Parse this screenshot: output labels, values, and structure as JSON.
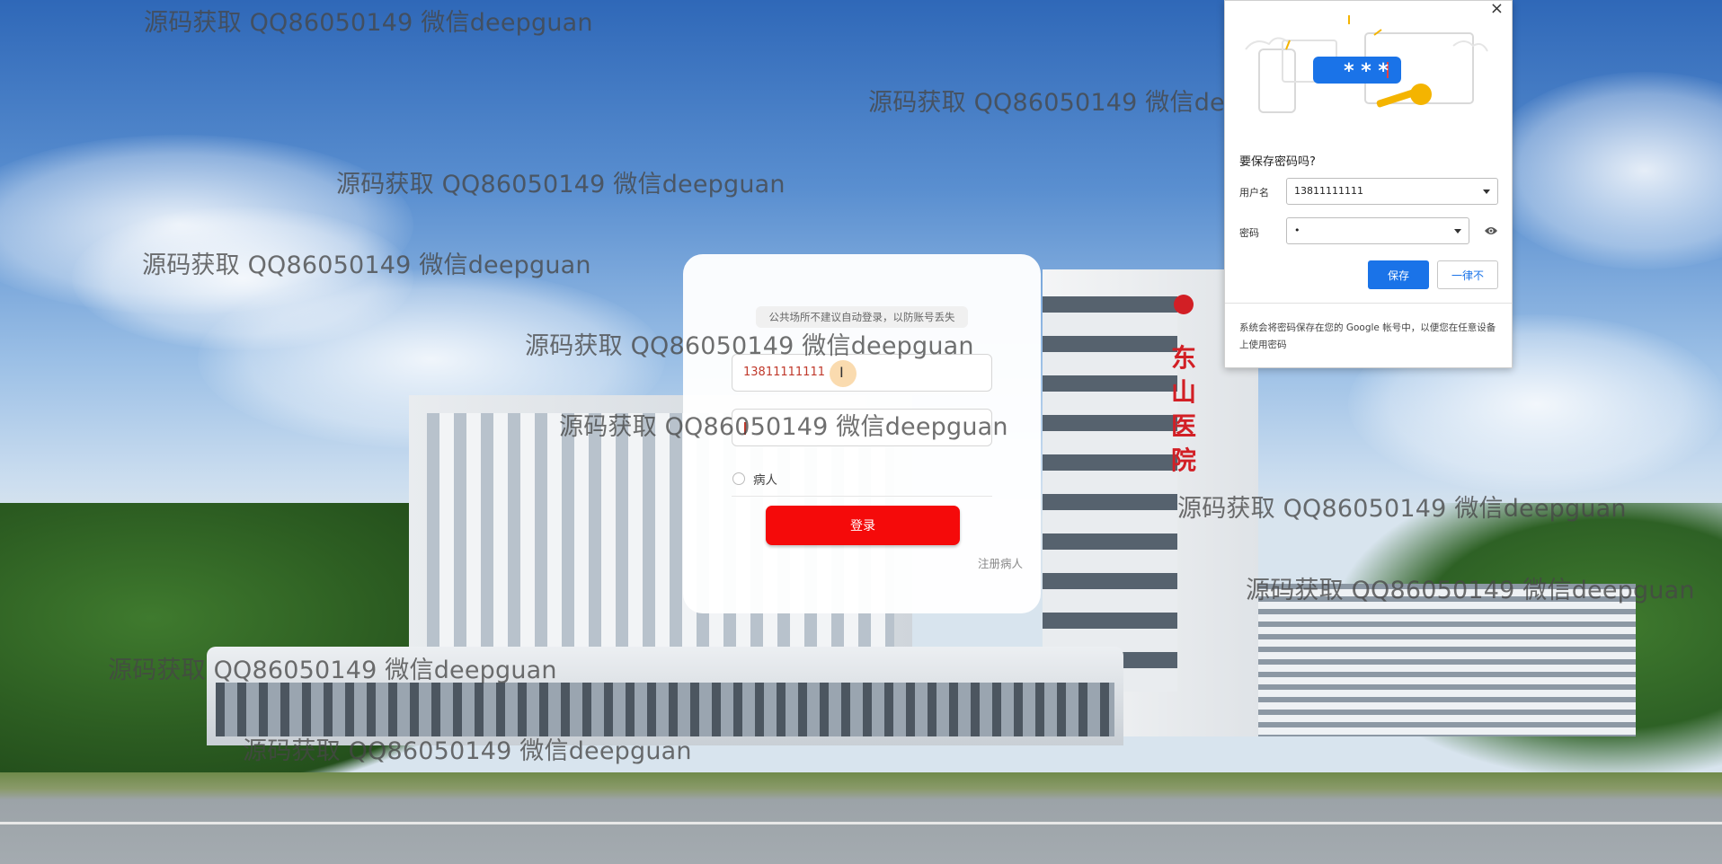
{
  "watermark_text": "源码获取 QQ86050149 微信deepguan",
  "login": {
    "warning": "公共场所不建议自动登录，以防账号丢失",
    "username_value": "13811111111",
    "role_label": "病人",
    "login_button": "登录",
    "register_link": "注册病人"
  },
  "background": {
    "tower_sign": "东山医院"
  },
  "save_password_popup": {
    "close_glyph": "×",
    "stars": "* * *",
    "title": "要保存密码吗?",
    "username_label": "用户名",
    "username_value": "13811111111",
    "password_label": "密码",
    "password_value": "•",
    "save_button": "保存",
    "never_button": "一律不",
    "footer": "系统会将密码保存在您的 Google 帐号中，以便您在任意设备上使用密码"
  },
  "colors": {
    "login_button": "#f50a0a",
    "primary_blue": "#1a73e8",
    "hospital_red": "#d21f25"
  }
}
